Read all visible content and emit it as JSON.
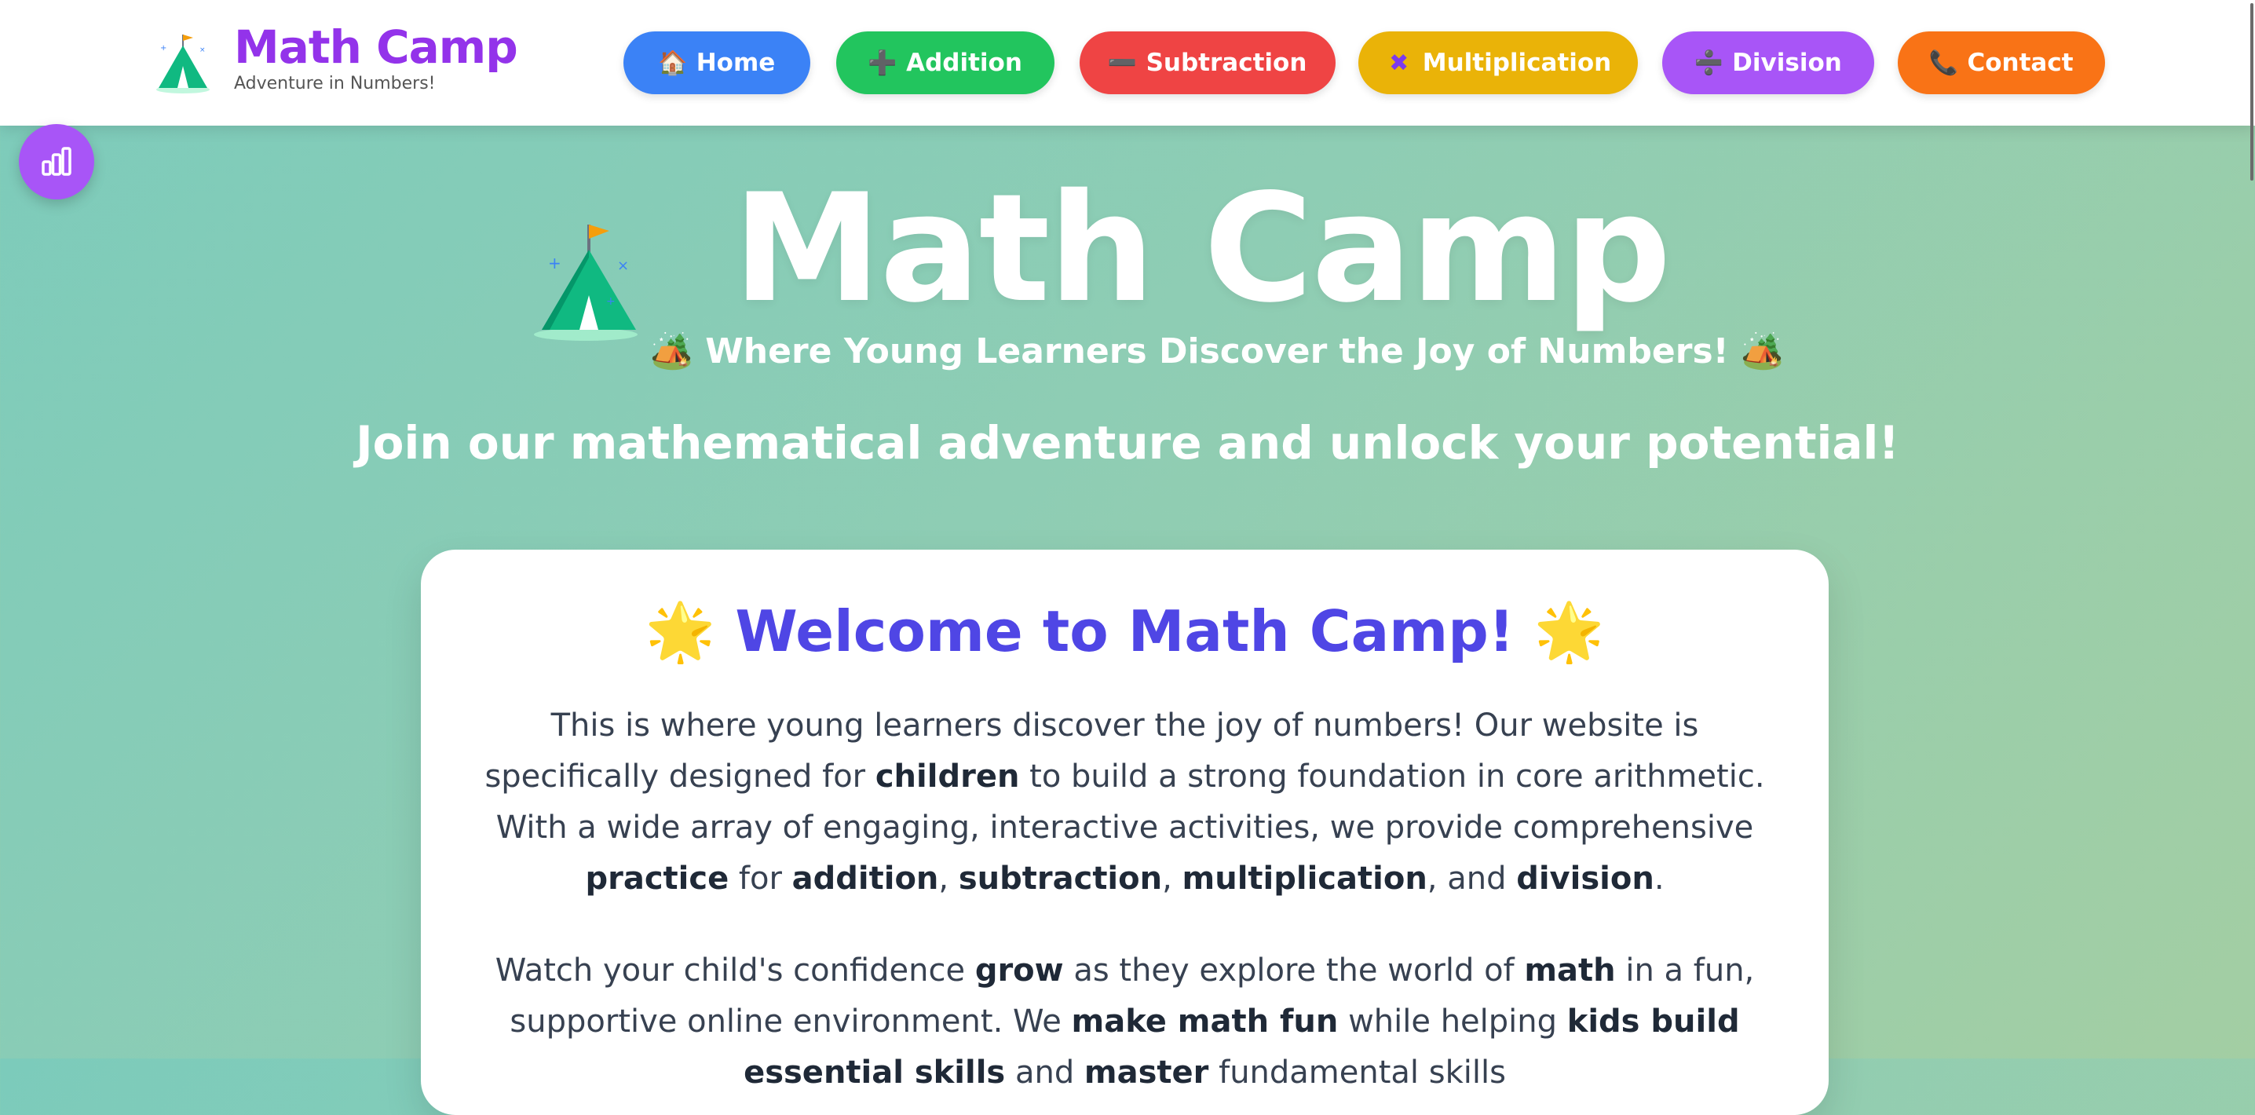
{
  "header": {
    "brand_title": "Math Camp",
    "brand_subtitle": "Adventure in Numbers!"
  },
  "nav": [
    {
      "label": "Home",
      "icon": "house-icon",
      "emoji": "🏠",
      "color": "#3b82f6"
    },
    {
      "label": "Addition",
      "icon": "plus-icon",
      "emoji": "➕",
      "color": "#22c55e"
    },
    {
      "label": "Subtraction",
      "icon": "minus-icon",
      "emoji": "➖",
      "color": "#ef4444"
    },
    {
      "label": "Multiplication",
      "icon": "multiply-icon",
      "emoji": "✖",
      "color": "#eab308"
    },
    {
      "label": "Division",
      "icon": "divide-icon",
      "emoji": "➗",
      "color": "#a855f7"
    },
    {
      "label": "Contact",
      "icon": "phone-icon",
      "emoji": "📞",
      "color": "#f97316"
    }
  ],
  "floating_button": {
    "icon": "bar-chart-icon",
    "color": "#a855f7"
  },
  "hero": {
    "title": "Math Camp",
    "subtitle": "🏕️ Where Young Learners Discover the Joy of Numbers! 🏕️",
    "tagline": "Join our mathematical adventure and unlock your potential!"
  },
  "welcome": {
    "title": "🌟 Welcome to Math Camp! 🌟",
    "p1": {
      "t1": "This is where young learners discover the joy of numbers! Our website is specifically designed for ",
      "b1": "children",
      "t2": " to build a strong foundation in core arithmetic. With a wide array of engaging, interactive activities, we provide comprehensive ",
      "b2": "practice",
      "t3": " for ",
      "b3": "addition",
      "t4": ", ",
      "b4": "subtraction",
      "t5": ", ",
      "b5": "multiplication",
      "t6": ", and ",
      "b6": "division",
      "t7": "."
    },
    "p2": {
      "t1": "Watch your child's confidence ",
      "b1": "grow",
      "t2": " as they explore the world of ",
      "b2": "math",
      "t3": " in a fun, supportive online environment. We ",
      "b3": "make math fun",
      "t4": " while helping ",
      "b4": "kids build essential skills",
      "t5": " and ",
      "b5": "master",
      "t6": " fundamental skills"
    }
  },
  "colors": {
    "brand_purple": "#9333ea",
    "welcome_indigo": "#4f46e5",
    "tent_green": "#10b981",
    "flag_orange": "#f59e0b"
  }
}
